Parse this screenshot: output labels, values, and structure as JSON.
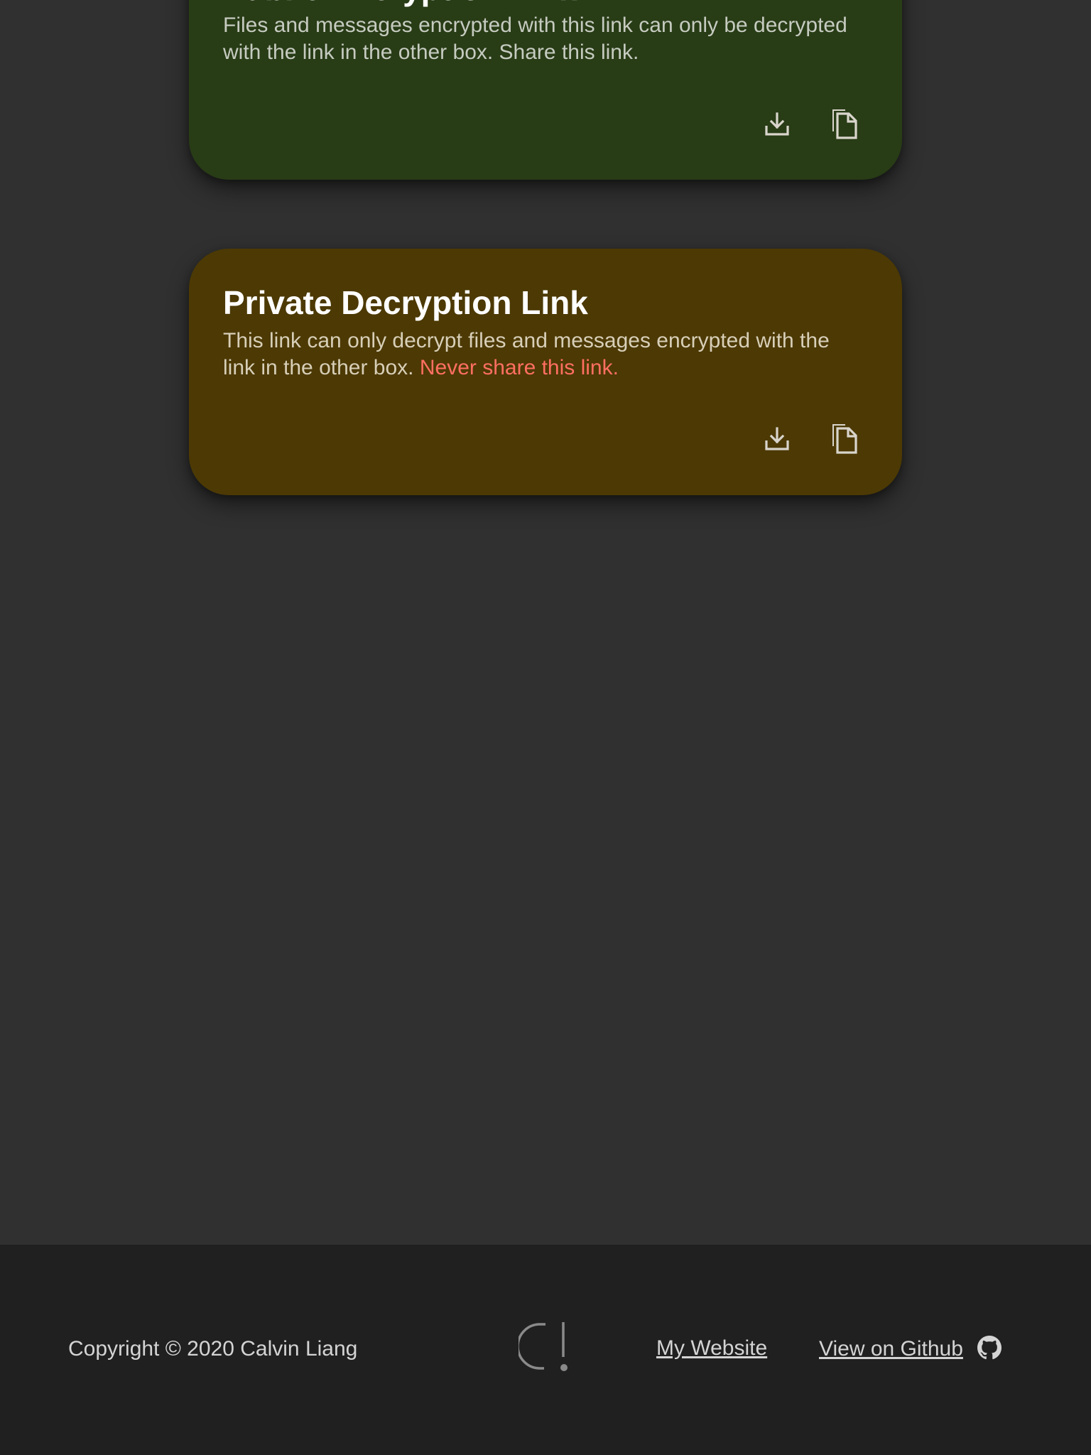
{
  "public_card": {
    "title": "Public Encryption Link",
    "description": "Files and messages encrypted with this link can only be decrypted with the link in the other box. Share this link.",
    "download_icon": "download-icon",
    "copy_icon": "copy-icon",
    "bg_color": "#283c16"
  },
  "private_card": {
    "title": "Private Decryption Link",
    "description": "This link can only decrypt files and messages encrypted with the link in the other box.",
    "warning": "Never share this link.",
    "download_icon": "download-icon",
    "copy_icon": "copy-icon",
    "bg_color": "#4c3904",
    "warning_color": "#ff6f61"
  },
  "footer": {
    "copyright": "Copyright © 2020 Calvin Liang",
    "logo_icon": "logo-icon",
    "my_website": "My Website",
    "github": "View on Github",
    "github_icon": "github-icon"
  }
}
